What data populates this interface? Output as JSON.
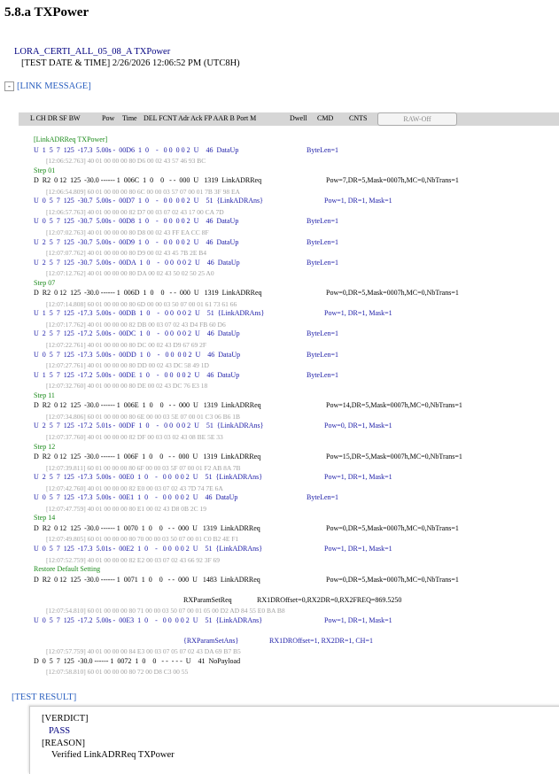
{
  "title": "5.8.a TXPower",
  "header": {
    "test_name": "LORA_CERTI_ALL_05_08_A TXPower",
    "test_date": "[TEST DATE & TIME] 2/26/2026 12:06:52 PM (UTC8H)"
  },
  "link_message": {
    "toggle": "-",
    "label": "[LINK MESSAGE]"
  },
  "columns": {
    "labels": [
      "L CH DR SF BW",
      "Pow",
      "Time",
      "DEL FCNT Adr Ack FP AAR B Port M",
      "Dwell",
      "CMD",
      "CNTS"
    ],
    "raw_button": "RAW-Off"
  },
  "log": [
    {
      "k": "s",
      "t": "[LinkADRReq TXPower]"
    },
    {
      "k": "u",
      "c": "U  1  5  7  125  -17.3  5.00s -  00D6  1  0    -   0 0  0 0 2  U    46  DataUp",
      "r": "ByteLen=1"
    },
    {
      "k": "r",
      "t": "[12:06:52.763] 40 01 00 00 00 80 D6 00 02 43 57 46 93 BC"
    },
    {
      "k": "s",
      "t": "Step 01"
    },
    {
      "k": "d",
      "c": "D  R2  0 12  125  -30.0 ------ 1  006C  1  0    0   - -  000  U   1319  LinkADRReq",
      "r": "Pow=7,DR=5,Mask=0007h,MC=0,NbTrans=1"
    },
    {
      "k": "r",
      "t": "[12:06:54.809] 60 01 00 00 00 80 6C 00 00 03 57 07 00 01 7B 3F 98 EA"
    },
    {
      "k": "a",
      "c": "U  0  5  7  125  -30.7  5.00s -  00D7  1  0    -   0 0  0 0 2  U    51  {LinkADRAns}",
      "r": "Pow=1, DR=1, Mask=1"
    },
    {
      "k": "r",
      "t": "[12:06:57.763] 40 01 00 00 00 82 D7 00 03 07 02 43 17 00 CA 7D"
    },
    {
      "k": "u",
      "c": "U  0  5  7  125  -30.7  5.00s -  00D8  1  0    -   0 0  0 0 2  U    46  DataUp",
      "r": "ByteLen=1"
    },
    {
      "k": "r",
      "t": "[12:07:02.763] 40 01 00 00 00 80 D8 00 02 43 FF EA CC 8F"
    },
    {
      "k": "u",
      "c": "U  2  5  7  125  -30.7  5.00s -  00D9  1  0    -   0 0  0 0 2  U    46  DataUp",
      "r": "ByteLen=1"
    },
    {
      "k": "r",
      "t": "[12:07:07.762] 40 01 00 00 00 80 D9 00 02 43 45 7B 2E B4"
    },
    {
      "k": "u",
      "c": "U  2  5  7  125  -30.7  5.00s -  00DA  1  0    -   0 0  0 0 2  U    46  DataUp",
      "r": "ByteLen=1"
    },
    {
      "k": "r",
      "t": "[12:07:12.762] 40 01 00 00 00 80 DA 00 02 43 50 02 50 25 A0"
    },
    {
      "k": "s",
      "t": "Step 07"
    },
    {
      "k": "d",
      "c": "D  R2  0 12  125  -30.0 ------ 1  006D  1  0    0   - -  000  U   1319  LinkADRReq",
      "r": "Pow=0,DR=5,Mask=0007h,MC=0,NbTrans=1"
    },
    {
      "k": "r",
      "t": "[12:07:14.808] 60 01 00 00 00 80 6D 00 00 03 50 07 00 01 61 73 61 66"
    },
    {
      "k": "a",
      "c": "U  1  5  7  125  -17.3  5.00s -  00DB  1  0    -   0 0  0 0 2  U    51  {LinkADRAns}",
      "r": "Pow=1, DR=1, Mask=1"
    },
    {
      "k": "r",
      "t": "[12:07:17.762] 40 01 00 00 00 82 DB 00 03 07 02 43 D4 FB 60 D6"
    },
    {
      "k": "u",
      "c": "U  2  5  7  125  -17.2  5.00s -  00DC  1  0    -   0 0  0 0 2  U    46  DataUp",
      "r": "ByteLen=1"
    },
    {
      "k": "r",
      "t": "[12:07:22.761] 40 01 00 00 00 80 DC 00 02 43 D9 67 69 2F"
    },
    {
      "k": "u",
      "c": "U  0  5  7  125  -17.3  5.00s -  00DD  1  0    -   0 0  0 0 2  U    46  DataUp",
      "r": "ByteLen=1"
    },
    {
      "k": "r",
      "t": "[12:07:27.761] 40 01 00 00 00 80 DD 00 02 43 DC 58 49 1D"
    },
    {
      "k": "u",
      "c": "U  1  5  7  125  -17.2  5.00s -  00DE  1  0    -   0 0  0 0 2  U    46  DataUp",
      "r": "ByteLen=1"
    },
    {
      "k": "r",
      "t": "[12:07:32.760] 40 01 00 00 00 80 DE 00 02 43 DC 76 E3 18"
    },
    {
      "k": "s",
      "t": "Step 11"
    },
    {
      "k": "d",
      "c": "D  R2  0 12  125  -30.0 ------ 1  006E  1  0    0   - -  000  U   1319  LinkADRReq",
      "r": "Pow=14,DR=5,Mask=0007h,MC=0,NbTrans=1"
    },
    {
      "k": "r",
      "t": "[12:07:34.806] 60 01 00 00 00 80 6E 00 00 03 5E 07 00 01 C3 06 B6 1B"
    },
    {
      "k": "a",
      "c": "U  2  5  7  125  -17.2  5.01s -  00DF  1  0    -   0 0  0 0 2  U    51  {LinkADRAns}",
      "r": "Pow=0, DR=1, Mask=1"
    },
    {
      "k": "r",
      "t": "[12:07:37.760] 40 01 00 00 00 82 DF 00 03 03 02 43 08 BE 5E 33"
    },
    {
      "k": "s",
      "t": "Step 12"
    },
    {
      "k": "d",
      "c": "D  R2  0 12  125  -30.0 ------ 1  006F  1  0    0   - -  000  U   1319  LinkADRReq",
      "r": "Pow=15,DR=5,Mask=0007h,MC=0,NbTrans=1"
    },
    {
      "k": "r",
      "t": "[12:07:39.811] 60 01 00 00 00 80 6F 00 00 03 5F 07 00 01 F2 AB 8A 7B"
    },
    {
      "k": "a",
      "c": "U  2  5  7  125  -17.3  5.00s -  00E0  1  0    -   0 0  0 0 2  U    51  {LinkADRAns}",
      "r": "Pow=1, DR=1, Mask=1"
    },
    {
      "k": "r",
      "t": "[12:07:42.760] 40 01 00 00 00 82 E0 00 03 07 02 43 7D 74 7E 6A"
    },
    {
      "k": "u",
      "c": "U  0  5  7  125  -17.3  5.00s -  00E1  1  0    -   0 0  0 0 2  U    46  DataUp",
      "r": "ByteLen=1"
    },
    {
      "k": "r",
      "t": "[12:07:47.759] 40 01 00 00 00 80 E1 00 02 43 D8 0B 2C 19"
    },
    {
      "k": "s",
      "t": "Step 14"
    },
    {
      "k": "d",
      "c": "D  R2  0 12  125  -30.0 ------ 1  0070  1  0    0   - -  000  U   1319  LinkADRReq",
      "r": "Pow=0,DR=5,Mask=0007h,MC=0,NbTrans=1"
    },
    {
      "k": "r",
      "t": "[12:07:49.805] 60 01 00 00 00 80 70 00 00 03 50 07 00 01 C0 B2 4E F1"
    },
    {
      "k": "a",
      "c": "U  0  5  7  125  -17.3  5.01s -  00E2  1  0    -   0 0  0 0 2  U    51  {LinkADRAns}",
      "r": "Pow=1, DR=1, Mask=1"
    },
    {
      "k": "r",
      "t": "[12:07:52.759] 40 01 00 00 00 82 E2 00 03 07 02 43 66 92 3F 69"
    },
    {
      "k": "s",
      "t": "Restore Default Setting"
    },
    {
      "k": "d",
      "c": "D  R2  0 12  125  -30.0 ------ 1  0071  1  0    0   - -  000  U   1483  LinkADRReq",
      "r": "Pow=0,DR=5,Mask=0007h,MC=0,NbTrans=1"
    },
    {
      "k": "x",
      "c": "RXParamSetReq",
      "r": "RX1DROffset=0,RX2DR=0,RX2FREQ=869.5250"
    },
    {
      "k": "r",
      "t": "[12:07:54.810] 60 01 00 00 00 80 71 00 00 03 50 07 00 01 05 00 D2 AD 84 55 E0 BA B8"
    },
    {
      "k": "a",
      "c": "U  0  5  7  125  -17.2  5.00s -  00E3  1  0    -   0 0  0 0 2  U    51  {LinkADRAns}",
      "r": "Pow=1, DR=1, Mask=1"
    },
    {
      "k": "y",
      "c": "{RXParamSetAns}",
      "r": "RX1DROffset=1, RX2DR=1, CH=1"
    },
    {
      "k": "r",
      "t": "[12:07:57.759] 40 01 00 00 00 84 E3 00 03 07 05 07 02 43 DA 69 B7 B5"
    },
    {
      "k": "n",
      "c": "D  0  5  7  125  -30.0 ------ 1  0072  1  0    0   - -  - - -  U    41  NoPayload"
    },
    {
      "k": "r",
      "t": "[12:07:58.810] 60 01 00 00 00 80 72 00 D8 C3 00 55"
    }
  ],
  "test_result": {
    "label": "[TEST RESULT]",
    "verdict_label": "[VERDICT]",
    "verdict": "PASS",
    "reason_label": "[REASON]",
    "reason": "Verified LinkADRReq TXPower"
  }
}
